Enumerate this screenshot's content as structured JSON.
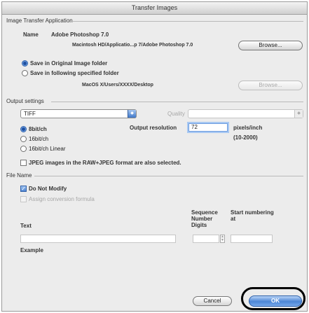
{
  "window": {
    "title": "Transfer Images"
  },
  "application_section": {
    "title": "Image Transfer Application",
    "name_label": "Name",
    "name_value": "Adobe Photoshop 7.0",
    "path_value": "Macintosh HD/Applicatio...p 7/Adobe Photoshop 7.0",
    "browse_label": "Browse...",
    "radio_original": "Save in Original Image folder",
    "radio_specified": "Save in following specified folder",
    "specified_path": "MacOS X/Users/XXXX/Desktop",
    "browse_disabled_label": "Browse..."
  },
  "output_section": {
    "title": "Output settings",
    "format_value": "TIFF",
    "quality_label": "Quality",
    "quality_value": "",
    "bits": [
      "8bit/ch",
      "16bit/ch",
      "16bit/ch Linear"
    ],
    "resolution_label": "Output resolution",
    "resolution_value": "72",
    "resolution_unit": "pixels/inch",
    "resolution_range": "(10-2000)",
    "jpeg_note": "JPEG images in the RAW+JPEG format are also selected."
  },
  "filename_section": {
    "title": "File Name",
    "do_not_modify": "Do Not Modify",
    "assign_formula": "Assign conversion formula",
    "col_text": "Text",
    "col_sequence": "Sequence Number Digits",
    "col_start": "Start numbering at",
    "text_value": "",
    "digits_value": "",
    "start_value": "",
    "example_label": "Example"
  },
  "footer": {
    "cancel_label": "Cancel",
    "ok_label": "OK"
  }
}
